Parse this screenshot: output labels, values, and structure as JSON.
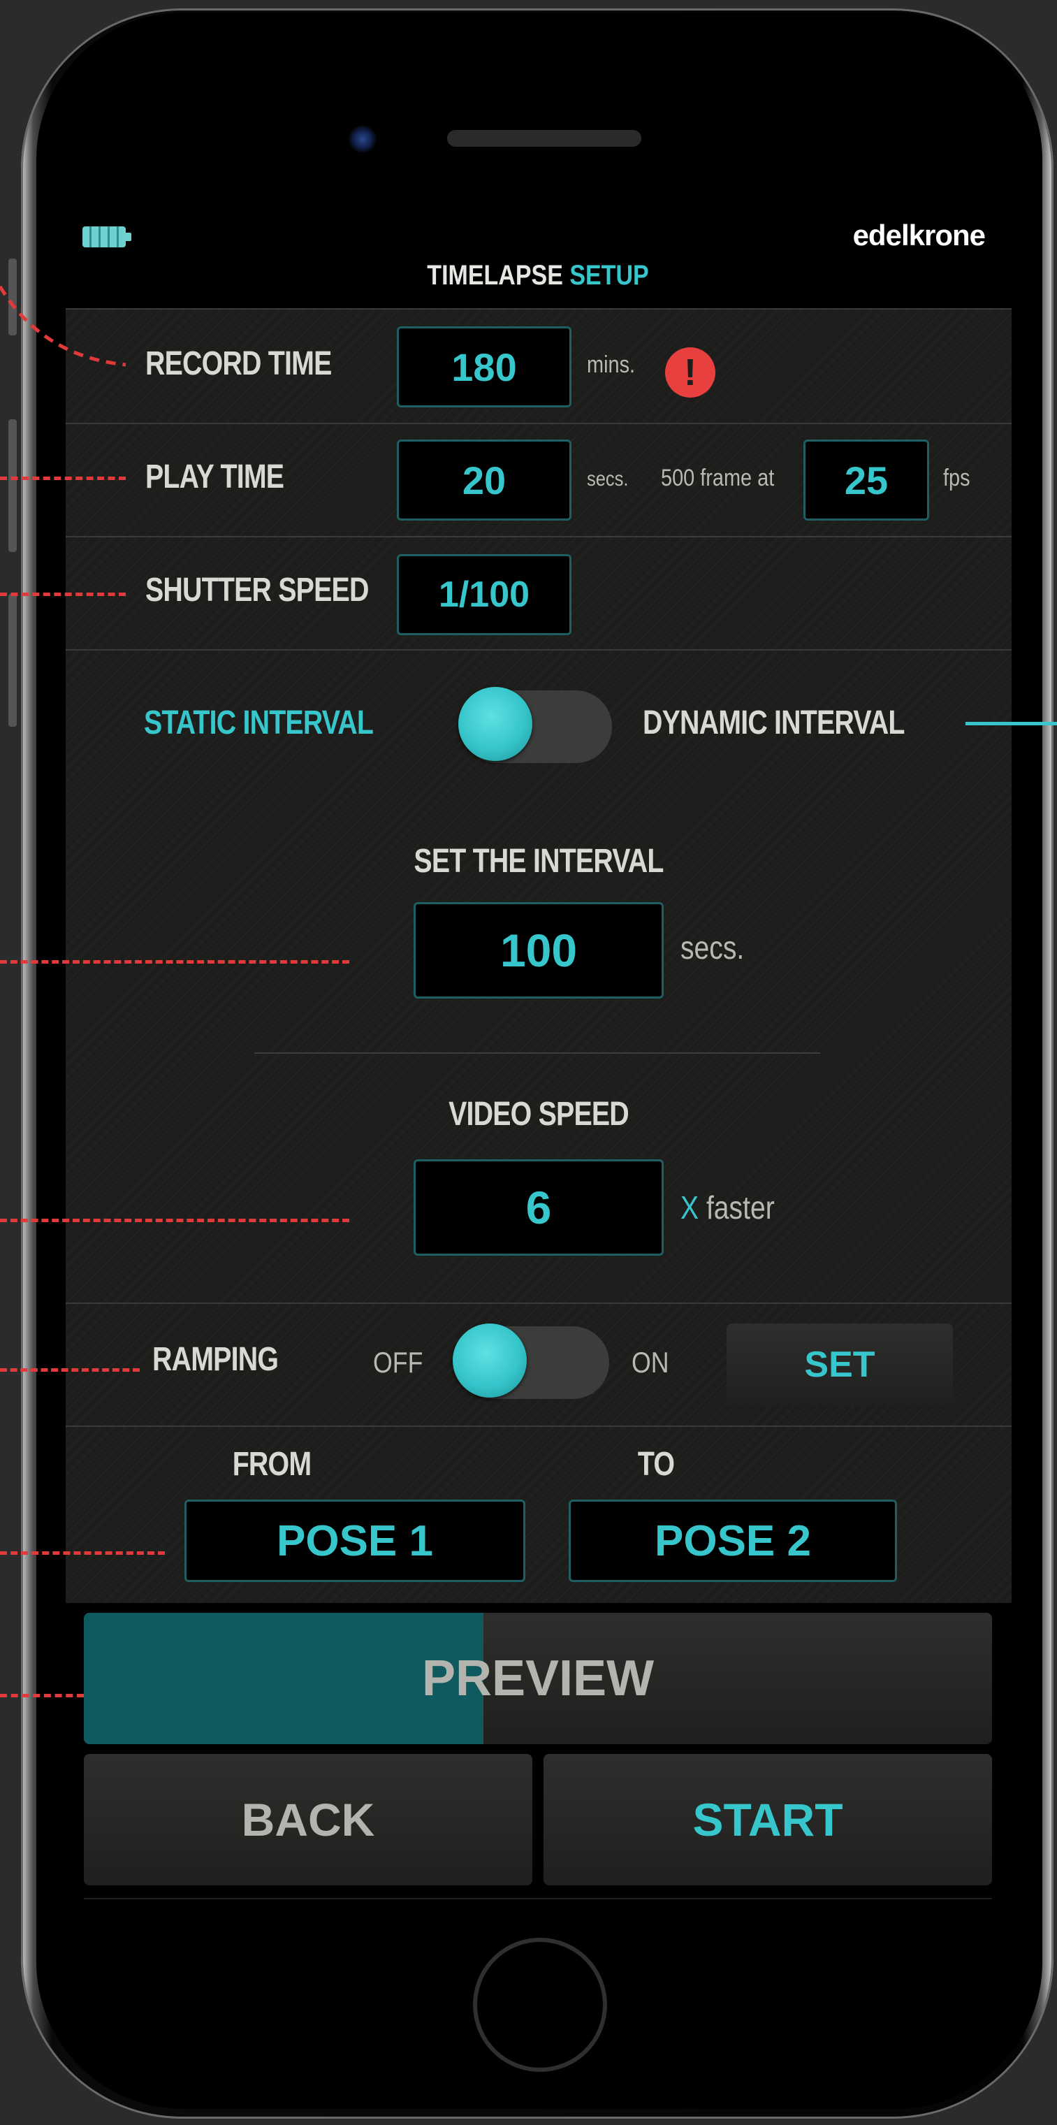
{
  "brand": "edelkrone",
  "header": {
    "title_part1": "TIMELAPSE",
    "title_part2": "SETUP"
  },
  "record_time": {
    "label": "RECORD TIME",
    "value": "180",
    "unit": "mins.",
    "warning_glyph": "!"
  },
  "play_time": {
    "label": "PLAY TIME",
    "value": "20",
    "unit": "secs.",
    "frame_text": "500 frame at",
    "fps_value": "25",
    "fps_unit": "fps"
  },
  "shutter_speed": {
    "label": "SHUTTER SPEED",
    "value": "1/100"
  },
  "interval_mode": {
    "static_label": "STATIC INTERVAL",
    "dynamic_label": "DYNAMIC INTERVAL",
    "selected": "static"
  },
  "interval": {
    "label": "SET THE INTERVAL",
    "value": "100",
    "unit": "secs."
  },
  "video_speed": {
    "label": "VIDEO SPEED",
    "value": "6",
    "x": "X",
    "unit": "faster"
  },
  "ramping": {
    "label": "RAMPING",
    "off_label": "OFF",
    "on_label": "ON",
    "set_label": "SET",
    "state": "off"
  },
  "poses": {
    "from_label": "FROM",
    "to_label": "TO",
    "from_value": "POSE 1",
    "to_value": "POSE 2"
  },
  "preview": {
    "label": "PREVIEW",
    "progress": 0.44
  },
  "actions": {
    "back_label": "BACK",
    "start_label": "START"
  },
  "colors": {
    "accent": "#37c6cb",
    "warning": "#e8403f",
    "annotation": "#e23a3a"
  },
  "icons": {
    "battery": "battery-icon",
    "camera": "camera-icon",
    "home": "home-button-icon"
  }
}
